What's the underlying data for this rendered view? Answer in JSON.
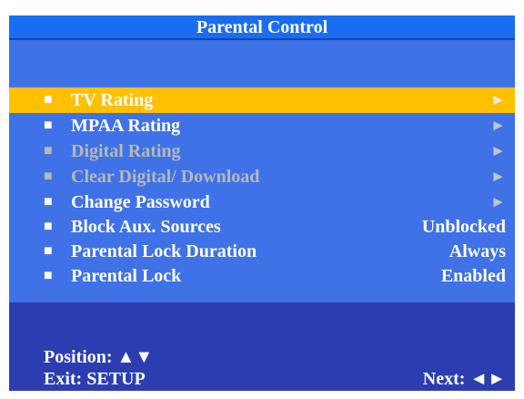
{
  "title": "Parental Control",
  "menu": {
    "items": [
      {
        "label": "TV Rating",
        "value": "►",
        "state": "selected"
      },
      {
        "label": "MPAA Rating",
        "value": "►",
        "state": "normal"
      },
      {
        "label": "Digital Rating",
        "value": "►",
        "state": "disabled"
      },
      {
        "label": "Clear Digital/ Download",
        "value": "►",
        "state": "disabled"
      },
      {
        "label": "Change Password",
        "value": "►",
        "state": "normal"
      },
      {
        "label": "Block Aux. Sources",
        "value": "Unblocked",
        "state": "normal"
      },
      {
        "label": "Parental Lock Duration",
        "value": "Always",
        "state": "normal"
      },
      {
        "label": "Parental Lock",
        "value": "Enabled",
        "state": "normal"
      }
    ],
    "bullet": "■"
  },
  "footer": {
    "position": "Position: ▲▼",
    "exit": "Exit: SETUP",
    "next": "Next: ◄►"
  },
  "colors": {
    "title_bar": "#1a6df0",
    "menu_background": "#3f72e6",
    "selected_highlight": "#ffc000",
    "footer_background": "#2c3db2",
    "disabled_text": "#b8b8b8"
  }
}
